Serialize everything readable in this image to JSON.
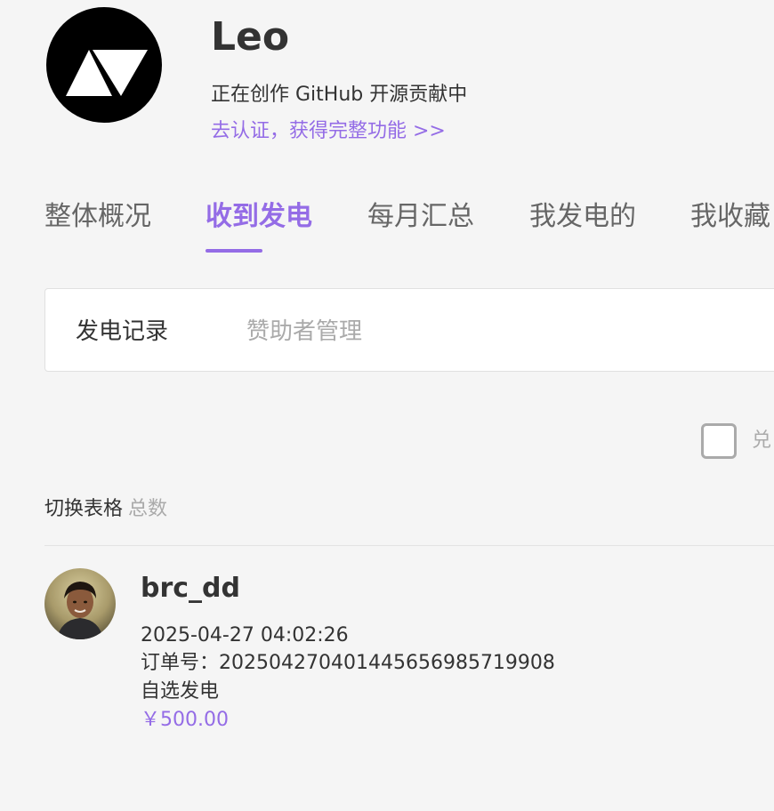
{
  "profile": {
    "name": "Leo",
    "bio": "正在创作 GitHub 开源贡献中",
    "verify_link": "去认证，获得完整功能 >>"
  },
  "tabs": [
    {
      "label": "整体概况",
      "active": false
    },
    {
      "label": "收到发电",
      "active": true
    },
    {
      "label": "每月汇总",
      "active": false
    },
    {
      "label": "我发电的",
      "active": false
    },
    {
      "label": "我收藏",
      "active": false
    }
  ],
  "subtabs": [
    {
      "label": "发电记录",
      "active": true
    },
    {
      "label": "赞助者管理",
      "active": false
    }
  ],
  "filter": {
    "checkbox_label": "兑",
    "checked": false
  },
  "toolbar": {
    "toggle_table": "切换表格",
    "total_label": "总数"
  },
  "records": [
    {
      "sponsor": "brc_dd",
      "time": "2025-04-27 04:02:26",
      "order": "订单号：20250427040144565698571990 8",
      "type": "自选发电",
      "amount": "￥500.00"
    }
  ],
  "colors": {
    "accent": "#946ce6",
    "background": "#f5f5f5"
  }
}
